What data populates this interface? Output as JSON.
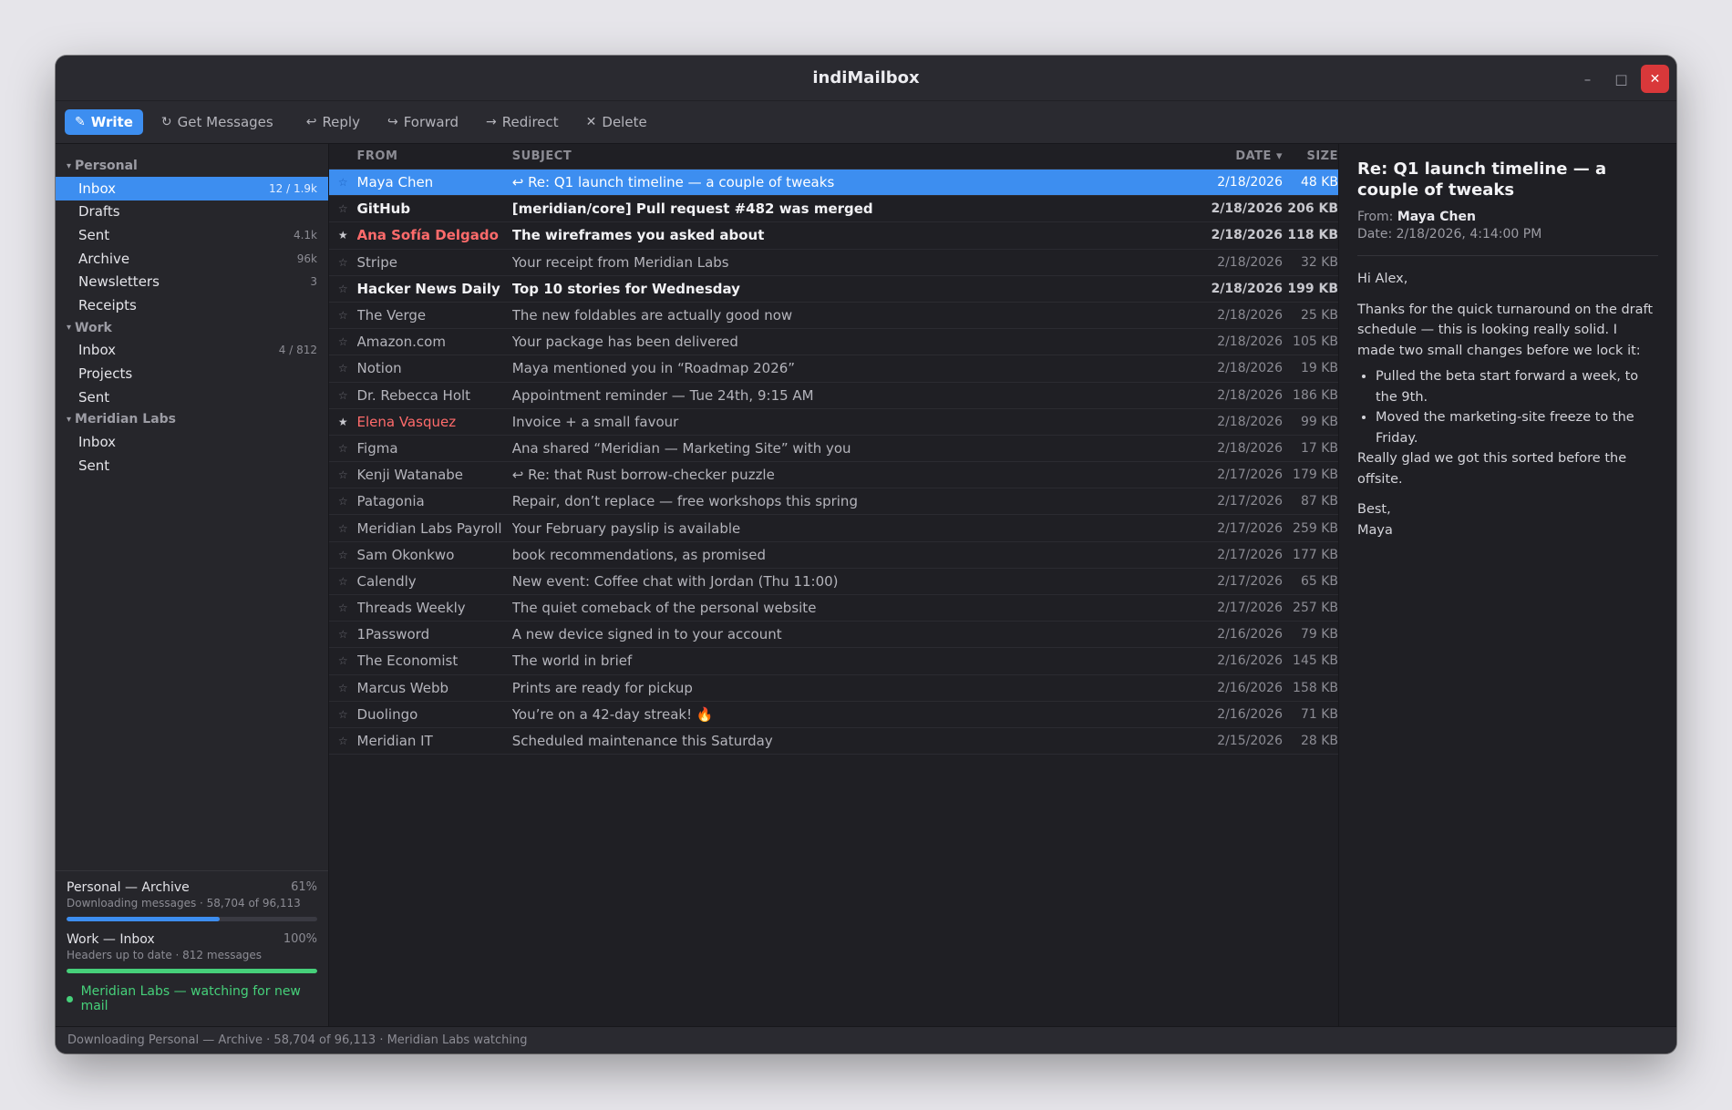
{
  "window": {
    "title": "indiMailbox"
  },
  "window_controls": {
    "minimize": "–",
    "maximize": "□",
    "close": "✕"
  },
  "toolbar": {
    "write": "Write",
    "get_messages": "Get Messages",
    "reply": "Reply",
    "forward": "Forward",
    "redirect": "Redirect",
    "delete": "Delete"
  },
  "sidebar": {
    "accounts": [
      {
        "name": "Personal",
        "folders": [
          {
            "name": "Inbox",
            "count": "12 / 1.9k",
            "selected": true
          },
          {
            "name": "Drafts",
            "count": ""
          },
          {
            "name": "Sent",
            "count": "4.1k"
          },
          {
            "name": "Archive",
            "count": "96k"
          },
          {
            "name": "Newsletters",
            "count": "3"
          },
          {
            "name": "Receipts",
            "count": ""
          }
        ]
      },
      {
        "name": "Work",
        "folders": [
          {
            "name": "Inbox",
            "count": "4 / 812"
          },
          {
            "name": "Projects",
            "count": ""
          },
          {
            "name": "Sent",
            "count": ""
          }
        ]
      },
      {
        "name": "Meridian Labs",
        "folders": [
          {
            "name": "Inbox",
            "count": ""
          },
          {
            "name": "Sent",
            "count": ""
          }
        ]
      }
    ],
    "sync": [
      {
        "title": "Personal — Archive",
        "percent_label": "61%",
        "progress": 0.61,
        "sub": "Downloading messages · 58,704 of 96,113",
        "color": "#3d8ef0"
      },
      {
        "title": "Work — Inbox",
        "percent_label": "100%",
        "progress": 1.0,
        "sub": "Headers up to date · 812 messages",
        "color": "#46d07a"
      }
    ],
    "watch": "Meridian Labs — watching for new mail"
  },
  "list": {
    "headers": {
      "from": "FROM",
      "subject": "SUBJECT",
      "date": "DATE ▾",
      "size": "SIZE"
    },
    "rows": [
      {
        "star": "☆",
        "from": "Maya Chen",
        "subject": "↩ Re: Q1 launch timeline — a couple of tweaks",
        "date": "2/18/2026",
        "size": "48 KB",
        "selected": true
      },
      {
        "star": "☆",
        "from": "GitHub",
        "subject": "[meridian/core] Pull request #482 was merged",
        "date": "2/18/2026",
        "size": "206 KB",
        "unread": true
      },
      {
        "star": "★",
        "from": "Ana Sofía Delgado",
        "subject": "The wireframes you asked about",
        "date": "2/18/2026",
        "size": "118 KB",
        "unread": true,
        "flagged": true
      },
      {
        "star": "☆",
        "from": "Stripe",
        "subject": "Your receipt from Meridian Labs",
        "date": "2/18/2026",
        "size": "32 KB"
      },
      {
        "star": "☆",
        "from": "Hacker News Daily",
        "subject": "Top 10 stories for Wednesday",
        "date": "2/18/2026",
        "size": "199 KB",
        "unread": true
      },
      {
        "star": "☆",
        "from": "The Verge",
        "subject": "The new foldables are actually good now",
        "date": "2/18/2026",
        "size": "25 KB"
      },
      {
        "star": "☆",
        "from": "Amazon.com",
        "subject": "Your package has been delivered",
        "date": "2/18/2026",
        "size": "105 KB"
      },
      {
        "star": "☆",
        "from": "Notion",
        "subject": "Maya mentioned you in “Roadmap 2026”",
        "date": "2/18/2026",
        "size": "19 KB"
      },
      {
        "star": "☆",
        "from": "Dr. Rebecca Holt",
        "subject": "Appointment reminder — Tue 24th, 9:15 AM",
        "date": "2/18/2026",
        "size": "186 KB"
      },
      {
        "star": "★",
        "from": "Elena Vasquez",
        "subject": "Invoice + a small favour",
        "date": "2/18/2026",
        "size": "99 KB",
        "flagged": true
      },
      {
        "star": "☆",
        "from": "Figma",
        "subject": "Ana shared “Meridian — Marketing Site” with you",
        "date": "2/18/2026",
        "size": "17 KB"
      },
      {
        "star": "☆",
        "from": "Kenji Watanabe",
        "subject": "↩ Re: that Rust borrow-checker puzzle",
        "date": "2/17/2026",
        "size": "179 KB"
      },
      {
        "star": "☆",
        "from": "Patagonia",
        "subject": "Repair, don’t replace — free workshops this spring",
        "date": "2/17/2026",
        "size": "87 KB"
      },
      {
        "star": "☆",
        "from": "Meridian Labs Payroll",
        "subject": "Your February payslip is available",
        "date": "2/17/2026",
        "size": "259 KB"
      },
      {
        "star": "☆",
        "from": "Sam Okonkwo",
        "subject": "book recommendations, as promised",
        "date": "2/17/2026",
        "size": "177 KB"
      },
      {
        "star": "☆",
        "from": "Calendly",
        "subject": "New event: Coffee chat with Jordan (Thu 11:00)",
        "date": "2/17/2026",
        "size": "65 KB"
      },
      {
        "star": "☆",
        "from": "Threads Weekly",
        "subject": "The quiet comeback of the personal website",
        "date": "2/17/2026",
        "size": "257 KB"
      },
      {
        "star": "☆",
        "from": "1Password",
        "subject": "A new device signed in to your account",
        "date": "2/16/2026",
        "size": "79 KB"
      },
      {
        "star": "☆",
        "from": "The Economist",
        "subject": "The world in brief",
        "date": "2/16/2026",
        "size": "145 KB"
      },
      {
        "star": "☆",
        "from": "Marcus Webb",
        "subject": "Prints are ready for pickup",
        "date": "2/16/2026",
        "size": "158 KB"
      },
      {
        "star": "☆",
        "from": "Duolingo",
        "subject": "You’re on a 42-day streak! 🔥",
        "date": "2/16/2026",
        "size": "71 KB"
      },
      {
        "star": "☆",
        "from": "Meridian IT",
        "subject": "Scheduled maintenance this Saturday",
        "date": "2/15/2026",
        "size": "28 KB"
      }
    ]
  },
  "preview": {
    "subject": "Re: Q1 launch timeline — a couple of tweaks",
    "from_label": "From:",
    "from": "Maya Chen",
    "date_label": "Date:",
    "date": "2/18/2026, 4:14:00 PM",
    "greeting": "Hi Alex,",
    "para1": "Thanks for the quick turnaround on the draft schedule — this is looking really solid. I made two small changes before we lock it:",
    "bullets": [
      "Pulled the beta start forward a week, to the 9th.",
      "Moved the marketing-site freeze to the Friday."
    ],
    "para2": "Really glad we got this sorted before the offsite.",
    "signoff": "Best,",
    "signature": "Maya"
  },
  "statusbar": {
    "text": "Downloading Personal — Archive · 58,704 of 96,113 · Meridian Labs watching"
  },
  "colors": {
    "accent": "#3d8ef0",
    "success": "#46d07a",
    "flag": "#ff6b6b",
    "close": "#d9383a"
  },
  "icons": {
    "write": "pencil-icon",
    "get_messages": "refresh-icon",
    "reply": "reply-icon",
    "forward": "forward-icon",
    "redirect": "redirect-icon",
    "delete": "close-icon"
  }
}
